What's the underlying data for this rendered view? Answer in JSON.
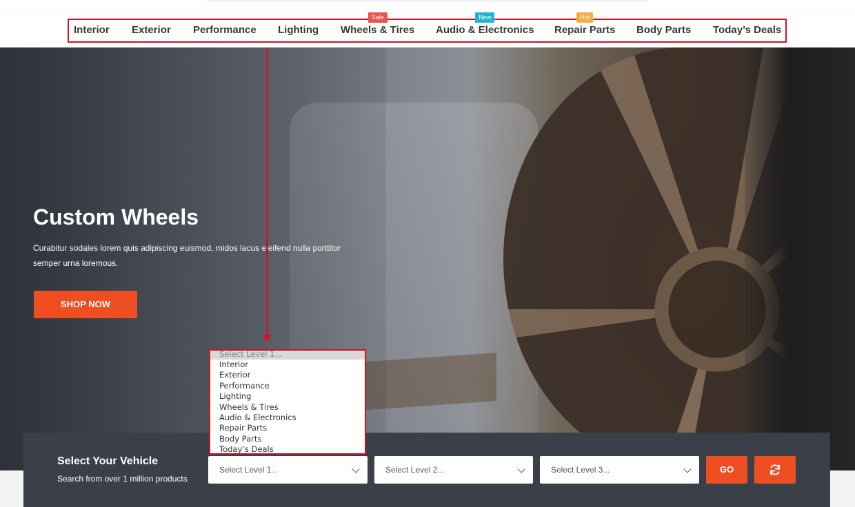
{
  "nav": {
    "items": [
      {
        "label": "Interior",
        "badge": ""
      },
      {
        "label": "Exterior",
        "badge": ""
      },
      {
        "label": "Performance",
        "badge": ""
      },
      {
        "label": "Lighting",
        "badge": ""
      },
      {
        "label": "Wheels & Tires",
        "badge": "Sale"
      },
      {
        "label": "Audio & Electronics",
        "badge": "New"
      },
      {
        "label": "Repair Parts",
        "badge": "Hot"
      },
      {
        "label": "Body Parts",
        "badge": ""
      },
      {
        "label": "Today’s Deals",
        "badge": ""
      }
    ]
  },
  "hero": {
    "title": "Custom Wheels",
    "description": "Curabitur sodales lorem quis adipiscing euismod, midos lacus eleifend nulla porttitor semper urna loremous.",
    "cta_label": "SHOP NOW"
  },
  "vehicle_search": {
    "title": "Select Your Vehicle",
    "subtitle": "Search from over 1 million products",
    "level1_value": "Select Level 1...",
    "level2_value": "Select Level 2...",
    "level3_value": "Select Level 3...",
    "go_label": "GO",
    "reset_icon": "refresh-icon"
  },
  "dropdown": {
    "options": [
      "Select Level 1...",
      "Interior",
      "Exterior",
      "Performance",
      "Lighting",
      "Wheels & Tires",
      "Audio & Electronics",
      "Repair Parts",
      "Body Parts",
      "Today’s Deals"
    ]
  },
  "colors": {
    "accent": "#ef4e23",
    "annotation": "#d6101f",
    "vehicle_bar": "#3b3f48",
    "badge_sale": "#e8544c",
    "badge_new": "#1fb5d6",
    "badge_hot": "#f5ac3d"
  }
}
